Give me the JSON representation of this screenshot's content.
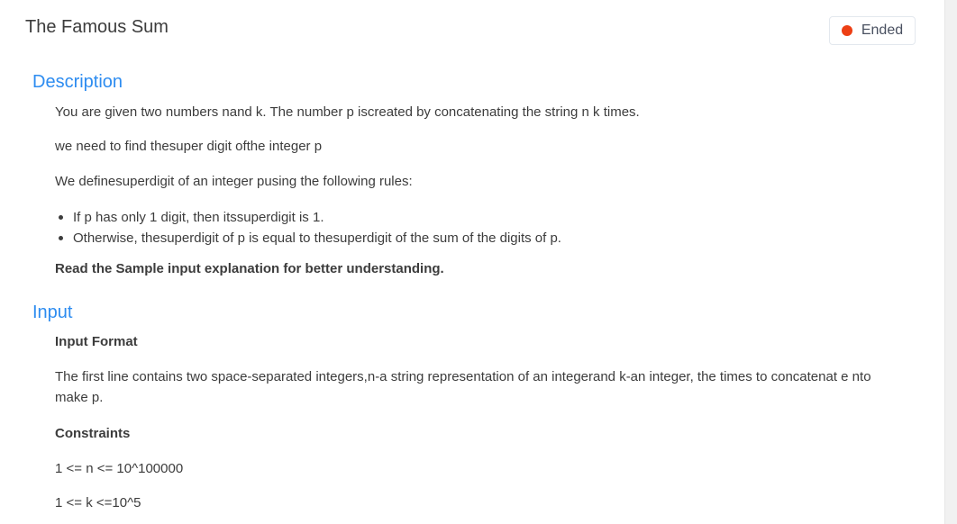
{
  "problem": {
    "title": "The Famous Sum",
    "status": {
      "label": "Ended",
      "color": "#ed3f14"
    }
  },
  "description": {
    "heading": "Description",
    "line1": "You are given two numbers nand k. The number p iscreated by concatenating the string n k times.",
    "line2": "we need to find thesuper digit ofthe integer p",
    "line3": "We definesuperdigit of an integer pusing the following rules:",
    "bullets": [
      "If p has only 1 digit, then itssuperdigit is 1.",
      "Otherwise, thesuperdigit of p is equal to thesuperdigit of the sum of the digits of p."
    ],
    "note": "Read the Sample input explanation for better understanding."
  },
  "input": {
    "heading": "Input",
    "format_label": "Input Format",
    "format_text": "The first line contains two space-separated integers,n-a string representation of an integerand k-an integer, the times to concatenat e nto make p.",
    "constraints_label": "Constraints",
    "constraint1": "1 <= n <= 10^100000",
    "constraint2": "1 <= k <=10^5"
  },
  "colors": {
    "accent": "#2d8cf0",
    "text": "#3c3c3c"
  }
}
